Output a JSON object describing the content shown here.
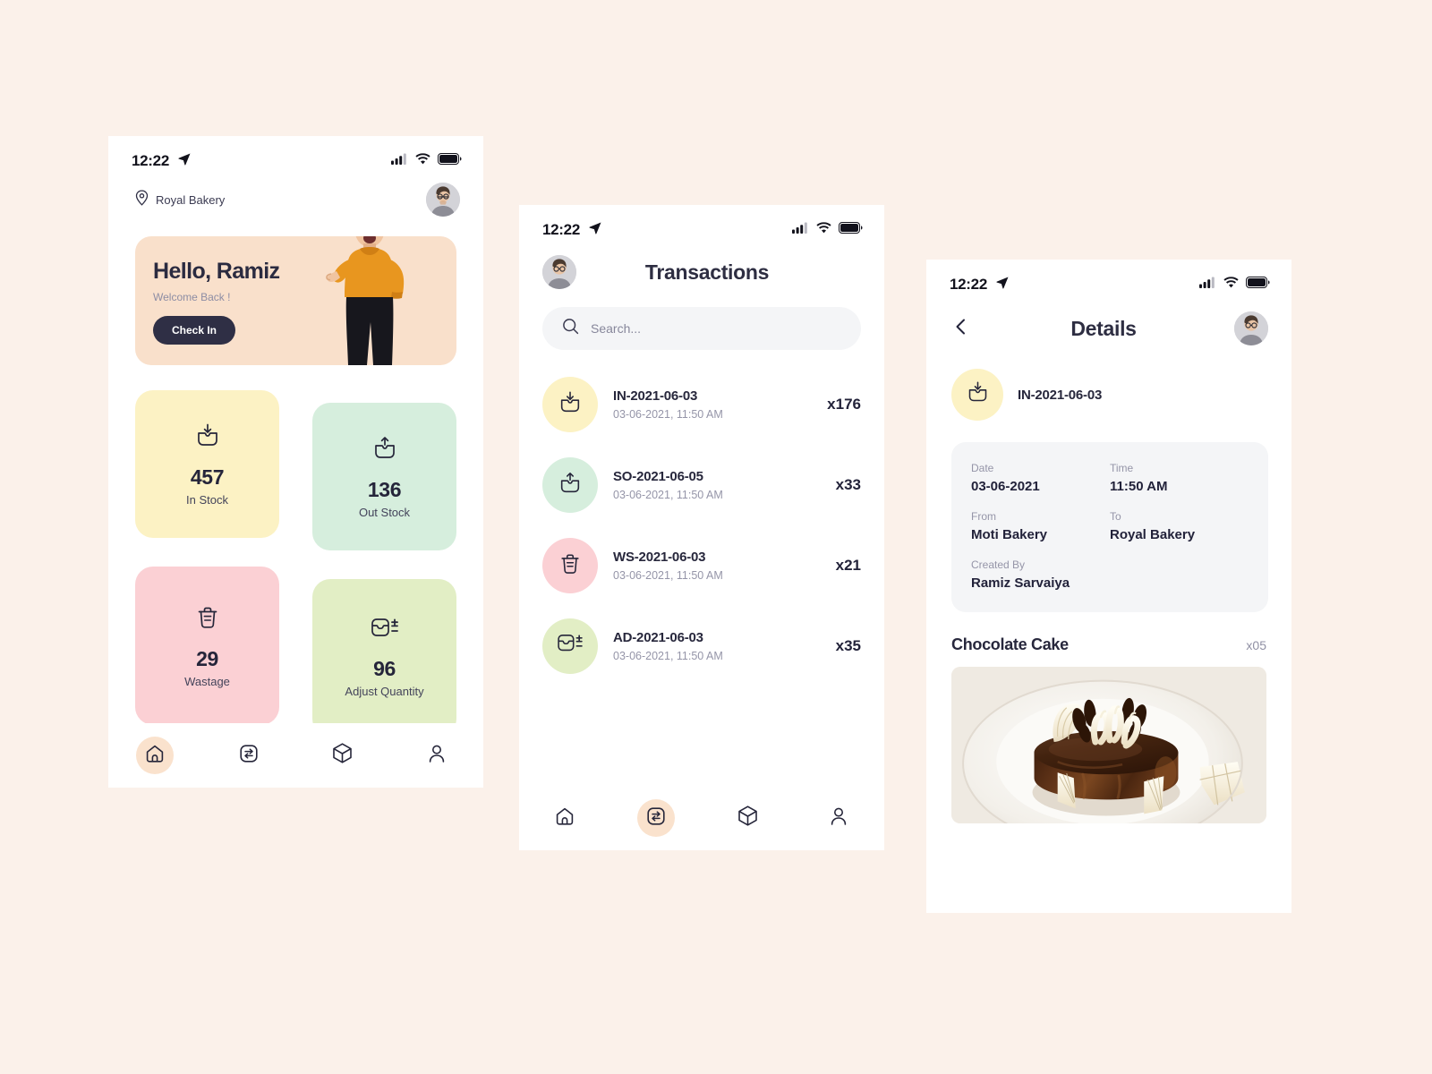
{
  "statusbar": {
    "time": "12:22",
    "icons": [
      "location-arrow-icon",
      "cellular-signal-icon",
      "wifi-icon",
      "battery-icon"
    ]
  },
  "home": {
    "location": "Royal Bakery",
    "hero": {
      "greeting": "Hello, Ramiz",
      "subtitle": "Welcome Back !",
      "button": "Check In",
      "bg_color": "#f9e0cb"
    },
    "stats": [
      {
        "value": "457",
        "label": "In Stock",
        "color": "#fcf2c4",
        "icon": "stock-in-icon"
      },
      {
        "value": "136",
        "label": "Out Stock",
        "color": "#d6eedd",
        "icon": "stock-out-icon"
      },
      {
        "value": "29",
        "label": "Wastage",
        "color": "#fbd0d4",
        "icon": "trash-icon"
      },
      {
        "value": "96",
        "label": "Adjust Quantity",
        "color": "#e2eec5",
        "icon": "adjust-quantity-icon"
      }
    ],
    "nav": [
      {
        "name": "home",
        "icon": "home-icon",
        "active": true
      },
      {
        "name": "transactions",
        "icon": "transfer-icon",
        "active": false
      },
      {
        "name": "inventory",
        "icon": "box-icon",
        "active": false
      },
      {
        "name": "profile",
        "icon": "person-icon",
        "active": false
      }
    ],
    "active_nav_bg": "#fae2cd"
  },
  "transactions": {
    "title": "Transactions",
    "search_placeholder": "Search...",
    "items": [
      {
        "ref": "IN-2021-06-03",
        "datetime": "03-06-2021, 11:50 AM",
        "count": "x176",
        "color": "#fcf2c4",
        "icon": "stock-in-icon"
      },
      {
        "ref": "SO-2021-06-05",
        "datetime": "03-06-2021, 11:50 AM",
        "count": "x33",
        "color": "#d6eedd",
        "icon": "stock-out-icon"
      },
      {
        "ref": "WS-2021-06-03",
        "datetime": "03-06-2021, 11:50 AM",
        "count": "x21",
        "color": "#fbd0d4",
        "icon": "trash-icon"
      },
      {
        "ref": "AD-2021-06-03",
        "datetime": "03-06-2021, 11:50 AM",
        "count": "x35",
        "color": "#e2eec5",
        "icon": "adjust-quantity-icon"
      }
    ],
    "nav": [
      {
        "name": "home",
        "icon": "home-icon",
        "active": false
      },
      {
        "name": "transactions",
        "icon": "transfer-icon",
        "active": true
      },
      {
        "name": "inventory",
        "icon": "box-icon",
        "active": false
      },
      {
        "name": "profile",
        "icon": "person-icon",
        "active": false
      }
    ]
  },
  "details": {
    "title": "Details",
    "back_icon": "chevron-left-icon",
    "ref": "IN-2021-06-03",
    "ref_icon_color": "#fcf2c4",
    "fields": {
      "date_label": "Date",
      "date_value": "03-06-2021",
      "time_label": "Time",
      "time_value": "11:50 AM",
      "from_label": "From",
      "from_value": "Moti Bakery",
      "to_label": "To",
      "to_value": "Royal Bakery",
      "created_label": "Created By",
      "created_value": "Ramiz Sarvaiya"
    },
    "product": {
      "name": "Chocolate Cake",
      "qty": "x05",
      "image": "chocolate-cake-photo"
    }
  }
}
